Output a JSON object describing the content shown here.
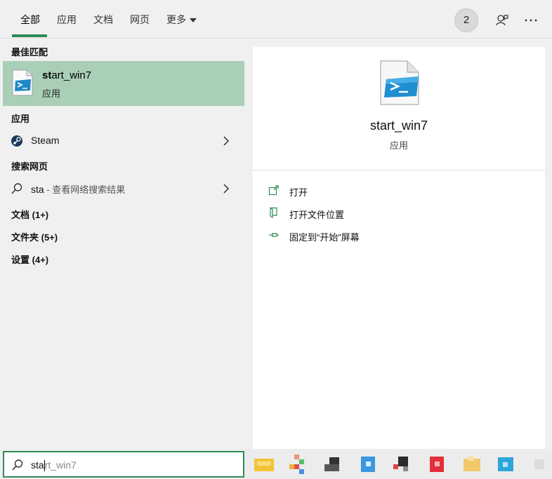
{
  "tabs": [
    {
      "label": "全部",
      "active": true
    },
    {
      "label": "应用",
      "active": false
    },
    {
      "label": "文档",
      "active": false
    },
    {
      "label": "网页",
      "active": false
    },
    {
      "label": "更多",
      "active": false
    }
  ],
  "header": {
    "badge_count": "2"
  },
  "left": {
    "best_match_header": "最佳匹配",
    "best_match": {
      "name_bold": "st",
      "name_rest": "art_win7",
      "type": "应用"
    },
    "apps_header": "应用",
    "apps": [
      {
        "label": "Steam"
      }
    ],
    "web_header": "搜索网页",
    "web": {
      "query": "sta",
      "suffix": " - 查看网络搜索结果"
    },
    "categories": [
      "文档 (1+)",
      "文件夹 (5+)",
      "设置 (4+)"
    ]
  },
  "right": {
    "title": "start_win7",
    "type": "应用",
    "actions": [
      {
        "label": "打开",
        "icon": "open-icon"
      },
      {
        "label": "打开文件位置",
        "icon": "file-location-icon"
      },
      {
        "label": "固定到“开始”屏幕",
        "icon": "pin-icon"
      }
    ]
  },
  "search": {
    "typed": "sta",
    "ghost": "rt_win7"
  },
  "colors": {
    "accent": "#2e8b57",
    "selected_bg": "#a9cfb7",
    "pane_bg": "#f0f0f0",
    "detail_bg": "#ffffff"
  }
}
